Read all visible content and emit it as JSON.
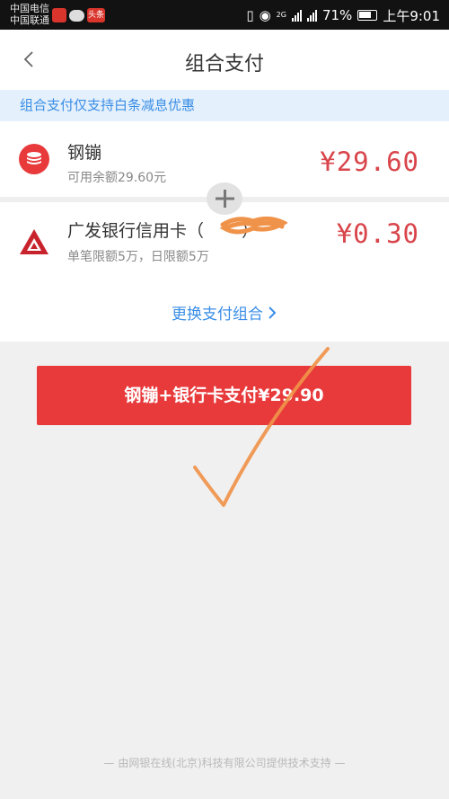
{
  "status_bar": {
    "carrier_1": "中国电信",
    "carrier_2": "中国联通",
    "app_badge": "头条",
    "network_tag": "2G",
    "battery": "71%",
    "time": "上午9:01"
  },
  "nav": {
    "title": "组合支付"
  },
  "notice": {
    "text": "组合支付仅支持白条减息优惠"
  },
  "payments": [
    {
      "name": "钢镚",
      "subtitle": "可用余额29.60元",
      "amount": "¥29.60"
    },
    {
      "name": "广发银行信用卡（",
      "name_suffix": "）",
      "subtitle": "单笔限额5万，日限额5万",
      "amount": "¥0.30"
    }
  ],
  "change_link": "更换支付组合",
  "pay_button": "钢镚+银行卡支付¥29.90",
  "footer": "— 由网银在线(北京)科技有限公司提供技术支持 —",
  "colors": {
    "accent_red": "#e8393b",
    "amount_red": "#d8454b",
    "link_blue": "#3a8ee6",
    "notice_bg": "#e4f0fc",
    "annotation_orange": "#f0934a"
  }
}
